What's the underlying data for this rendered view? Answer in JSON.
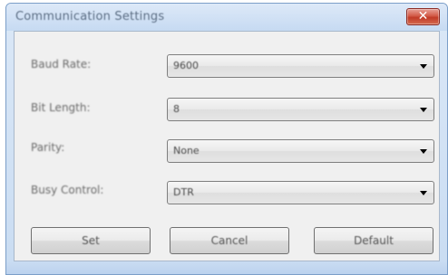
{
  "window": {
    "title": "Communication Settings",
    "close_glyph": "✕"
  },
  "fields": [
    {
      "label": "Baud Rate:",
      "value": "9600"
    },
    {
      "label": "Bit Length:",
      "value": "8"
    },
    {
      "label": "Parity:",
      "value": "None"
    },
    {
      "label": "Busy Control:",
      "value": "DTR"
    }
  ],
  "buttons": {
    "set": "Set",
    "cancel": "Cancel",
    "default": "Default"
  },
  "icons": {
    "close": "close-icon",
    "dropdown": "chevron-down-icon"
  }
}
